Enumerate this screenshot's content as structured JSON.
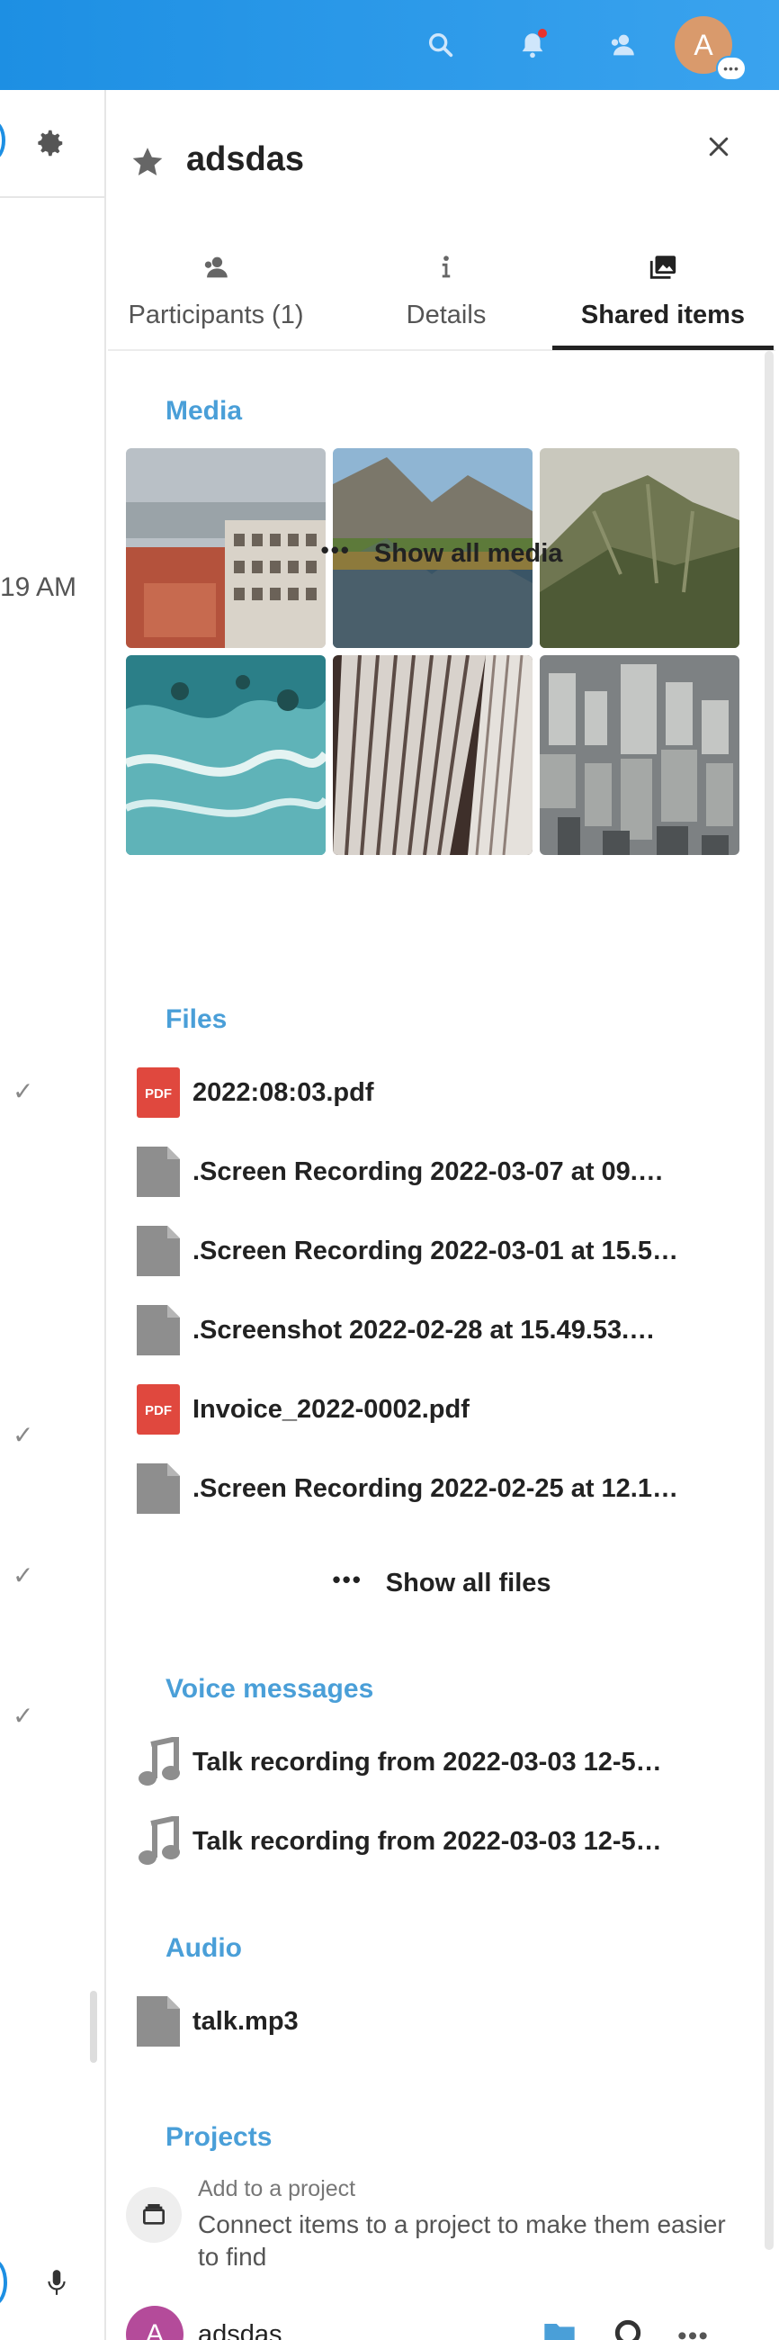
{
  "header": {
    "avatar_letter": "A",
    "icons": [
      "search-icon",
      "bell-icon",
      "contacts-icon"
    ],
    "accent": "#1d8fe3"
  },
  "left": {
    "time_fragment": "19 AM",
    "check_glyph": "✓"
  },
  "panel": {
    "title": "adsdas",
    "tabs": [
      {
        "label": "Participants (1)",
        "icon": "participants-icon"
      },
      {
        "label": "Details",
        "icon": "info-icon"
      },
      {
        "label": "Shared items",
        "icon": "images-icon",
        "active": true
      }
    ],
    "media": {
      "title": "Media",
      "show_all": "Show all media",
      "thumbnails": [
        "city-courtyard",
        "mountain-lake",
        "green-hills",
        "ocean-waves",
        "skyscraper-facade",
        "city-aerial"
      ]
    },
    "files": {
      "title": "Files",
      "items": [
        {
          "name": "2022:08:03.pdf",
          "type": "pdf"
        },
        {
          "name": ".Screen Recording 2022-03-07 at 09.…",
          "type": "generic"
        },
        {
          "name": ".Screen Recording 2022-03-01 at 15.5…",
          "type": "generic"
        },
        {
          "name": ".Screenshot 2022-02-28 at 15.49.53.…",
          "type": "generic"
        },
        {
          "name": "Invoice_2022-0002.pdf",
          "type": "pdf"
        },
        {
          "name": ".Screen Recording 2022-02-25 at 12.1…",
          "type": "generic"
        }
      ],
      "show_all": "Show all files",
      "pdf_badge": "PDF"
    },
    "voice": {
      "title": "Voice messages",
      "items": [
        {
          "name": "Talk recording from 2022-03-03 12-5…"
        },
        {
          "name": "Talk recording from 2022-03-03 12-5…"
        }
      ]
    },
    "audio": {
      "title": "Audio",
      "items": [
        {
          "name": "talk.mp3"
        }
      ]
    },
    "projects": {
      "title": "Projects",
      "add_label": "Add to a project",
      "help": "Connect items to a project to make them easier to find"
    },
    "bottom": {
      "avatar_letter": "A",
      "name": "adsdas"
    }
  }
}
